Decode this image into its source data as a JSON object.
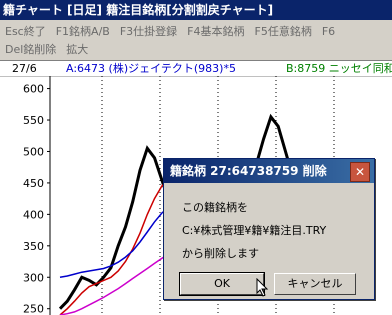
{
  "window": {
    "title": "籍チャート [日足] 籍注目銘柄[分割割戻チャート]"
  },
  "toolbar": {
    "row1": [
      "Esc終了",
      "F1銘柄A/B",
      "F3仕掛登録",
      "F4基本銘柄",
      "F5任意銘柄",
      "F6"
    ],
    "row2": [
      "Del銘削除",
      "拡大"
    ]
  },
  "chart": {
    "date_label": "27/6",
    "stock_a": "A:6473 (株)ジェイテクト(983)*5",
    "stock_b": "B:8759 ニッセイ同和",
    "colors": {
      "stock_a": "#0000cc",
      "stock_b": "#008000",
      "price": "#000000",
      "ma_red": "#cc0000",
      "ma_blue": "#0000cc",
      "ma_magenta": "#cc00cc"
    }
  },
  "chart_data": {
    "type": "line",
    "yticks": [
      600,
      550,
      500,
      450,
      400,
      350,
      300,
      250
    ],
    "ylim": [
      240,
      620
    ],
    "series": [
      {
        "values": [
          250,
          262,
          280,
          300,
          295,
          288,
          300,
          315,
          350,
          380,
          420,
          470,
          505,
          490,
          455,
          420,
          380,
          340,
          310,
          300,
          290,
          310,
          330,
          350,
          380,
          410,
          450,
          480,
          520,
          555,
          540,
          500,
          460,
          430
        ]
      },
      {
        "values": [
          240,
          250,
          262,
          275,
          285,
          290,
          295,
          300,
          310,
          325,
          345,
          370,
          400,
          425,
          445,
          455,
          450,
          430,
          405,
          380,
          355,
          335,
          330,
          335,
          345,
          360,
          380,
          405,
          430,
          455,
          470,
          475,
          470,
          460
        ]
      },
      {
        "values": [
          300,
          302,
          305,
          308,
          310,
          312,
          314,
          318,
          324,
          332,
          342,
          356,
          372,
          388,
          402,
          412,
          418,
          416,
          410,
          400,
          390,
          380,
          372,
          368,
          368,
          372,
          380,
          390,
          402,
          416,
          428,
          438,
          444,
          448
        ]
      },
      {
        "values": [
          240,
          242,
          245,
          250,
          256,
          262,
          268,
          275,
          282,
          290,
          298,
          306,
          314,
          322,
          330,
          338,
          346,
          352,
          358,
          362,
          366,
          370,
          374,
          378,
          382,
          386,
          390,
          395,
          400,
          405,
          410,
          414,
          418,
          422
        ]
      }
    ]
  },
  "dialog": {
    "title": "籍銘柄 27:64738759 削除",
    "line1": "この籍銘柄を",
    "line2": "C:¥株式管理¥籍¥籍注目.TRY",
    "line3": "から削除します",
    "ok": "OK",
    "cancel": "キャンセル"
  }
}
